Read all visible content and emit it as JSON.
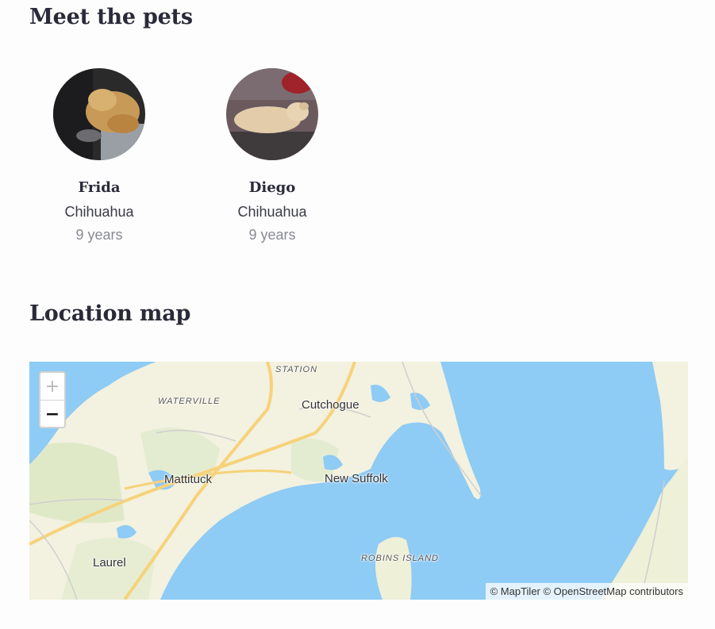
{
  "sections": {
    "pets_title": "Meet the pets",
    "map_title": "Location map"
  },
  "pets": [
    {
      "name": "Frida",
      "breed": "Chihuahua",
      "age": "9 years"
    },
    {
      "name": "Diego",
      "breed": "Chihuahua",
      "age": "9 years"
    }
  ],
  "map": {
    "zoom_in": "+",
    "zoom_out": "−",
    "labels": {
      "station": "STATION",
      "waterville": "WATERVILLE",
      "cutchogue": "Cutchogue",
      "mattituck": "Mattituck",
      "new_suffolk": "New Suffolk",
      "laurel": "Laurel",
      "robins_island": "ROBINS ISLAND"
    },
    "attribution": "© MapTiler © OpenStreetMap contributors",
    "colors": {
      "water": "#8ecbf5",
      "land": "#f3f1df",
      "green": "#dfe9c8",
      "road": "#f6d27a"
    }
  }
}
